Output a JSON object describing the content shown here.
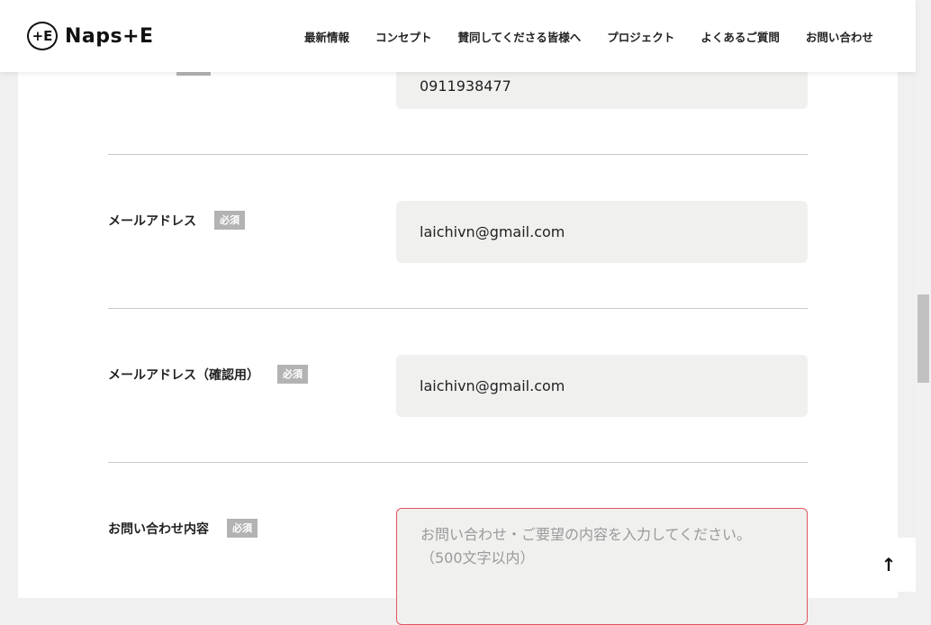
{
  "header": {
    "logo_text": "Naps+E",
    "logo_mark": "+E",
    "nav": [
      "最新情報",
      "コンセプト",
      "賛同してくださる皆様へ",
      "プロジェクト",
      "よくあるご質問",
      "お問い合わせ"
    ]
  },
  "form": {
    "phone": {
      "value": "0911938477"
    },
    "email": {
      "label": "メールアドレス",
      "badge": "必須",
      "value": "laichivn@gmail.com"
    },
    "email_confirm": {
      "label": "メールアドレス（確認用）",
      "badge": "必須",
      "value": "laichivn@gmail.com"
    },
    "inquiry": {
      "label": "お問い合わせ内容",
      "badge": "必須",
      "placeholder_line1": "お問い合わせ・ご要望の内容を入力してください。",
      "placeholder_line2": "（500文字以内）"
    }
  },
  "to_top": {
    "icon": "arrow-up-icon",
    "glyph": "↑"
  }
}
